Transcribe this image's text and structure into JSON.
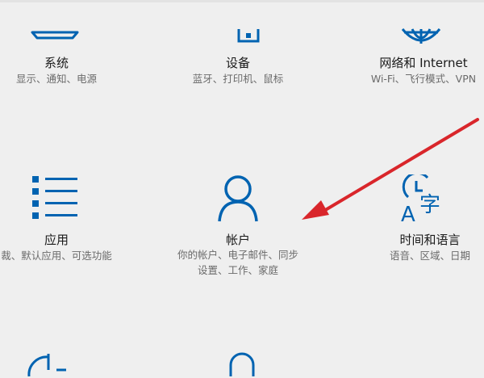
{
  "tiles": {
    "system": {
      "title": "系统",
      "desc": "显示、通知、电源",
      "icon": "laptop-icon"
    },
    "devices": {
      "title": "设备",
      "desc": "蓝牙、打印机、鼠标",
      "icon": "keyboard-device-icon"
    },
    "network": {
      "title": "网络和 Internet",
      "desc": "Wi-Fi、飞行模式、VPN",
      "icon": "globe-icon"
    },
    "apps": {
      "title": "应用",
      "desc": "裁、默认应用、可选功能",
      "icon": "apps-list-icon"
    },
    "accounts": {
      "title": "帐户",
      "desc1": "你的帐户、电子邮件、同步",
      "desc2": "设置、工作、家庭",
      "icon": "person-icon"
    },
    "time": {
      "title": "时间和语言",
      "desc": "语音、区域、日期",
      "icon": "clock-language-icon"
    },
    "update": {
      "icon": "update-sync-icon"
    },
    "privacy": {
      "icon": "lock-icon"
    }
  },
  "annotation": {
    "icon": "red-arrow-icon",
    "color": "#d9262b"
  },
  "accent": "#0063b1"
}
